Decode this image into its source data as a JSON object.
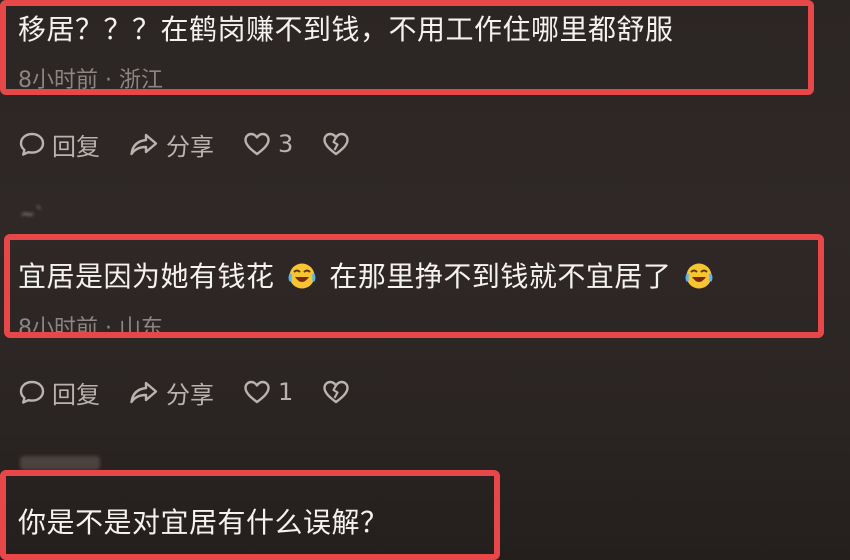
{
  "comments": [
    {
      "text": "移居？？？在鹤岗赚不到钱，不用工作住哪里都舒服",
      "meta": "8小时前 · 浙江",
      "actions": {
        "reply": "回复",
        "share": "分享",
        "likes": "3"
      }
    },
    {
      "username": "~`",
      "text_part1": "宜居是因为她有钱花",
      "text_part2": "在那里挣不到钱就不宜居了",
      "meta": "8小时前 · 山东",
      "actions": {
        "reply": "回复",
        "share": "分享",
        "likes": "1"
      }
    },
    {
      "text": "你是不是对宜居有什么误解？"
    }
  ],
  "icons": {
    "reply": "speech-bubble-icon",
    "share": "share-arrow-icon",
    "like": "heart-icon",
    "dislike": "broken-heart-icon",
    "emoji": "rolling-laughing-emoji"
  },
  "colors": {
    "highlight": "#e8474a",
    "background": "#2b2523",
    "text": "#f4f2f1",
    "meta": "#8d8582"
  }
}
